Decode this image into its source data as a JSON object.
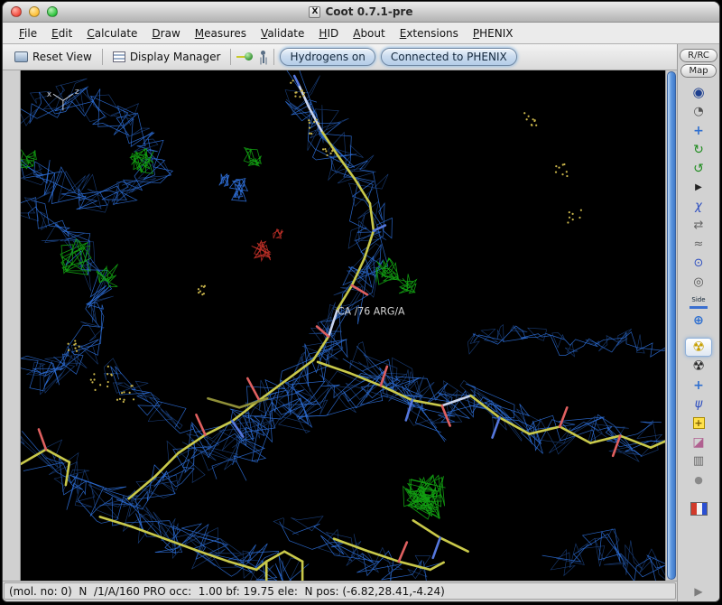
{
  "window": {
    "title": "Coot 0.7.1-pre",
    "icon_glyph": "X"
  },
  "menu": {
    "items": [
      {
        "label": "File"
      },
      {
        "label": "Edit"
      },
      {
        "label": "Calculate"
      },
      {
        "label": "Draw"
      },
      {
        "label": "Measures"
      },
      {
        "label": "Validate"
      },
      {
        "label": "HID"
      },
      {
        "label": "About"
      },
      {
        "label": "Extensions"
      },
      {
        "label": "PHENIX"
      }
    ]
  },
  "toolbar": {
    "reset_view": "Reset View",
    "display_manager": "Display Manager",
    "hydrogens_toggle": "Hydrogens on",
    "phenix_status": "Connected to PHENIX"
  },
  "right_panel": {
    "rrc_button": "R/RC",
    "map_button": "Map",
    "expand_glyph": "▶",
    "icons": [
      {
        "name": "view-sphere",
        "glyph": "◉"
      },
      {
        "name": "clock",
        "glyph": "◔"
      },
      {
        "name": "translate",
        "glyph": "+"
      },
      {
        "name": "rotate-zone",
        "glyph": "↻"
      },
      {
        "name": "torsion",
        "glyph": "↺"
      },
      {
        "name": "play",
        "glyph": "▶"
      },
      {
        "name": "chi-angles",
        "glyph": "χ"
      },
      {
        "name": "flip",
        "glyph": "⇄"
      },
      {
        "name": "backbone",
        "glyph": "≈"
      },
      {
        "name": "sphere-refine",
        "glyph": "⊙"
      },
      {
        "name": "eye",
        "glyph": "◎"
      },
      {
        "name": "side-view",
        "glyph": "Side"
      },
      {
        "name": "pan",
        "glyph": "⊕"
      },
      {
        "name": "real-space-refine",
        "glyph": "☢",
        "selected": true
      },
      {
        "name": "regularize",
        "glyph": "☢"
      },
      {
        "name": "rigid-body",
        "glyph": "+"
      },
      {
        "name": "rotamers",
        "glyph": "ψ"
      },
      {
        "name": "add-residue",
        "glyph": "+"
      },
      {
        "name": "mutate",
        "glyph": "◪"
      },
      {
        "name": "delete",
        "glyph": "▥"
      },
      {
        "name": "sphere",
        "glyph": "●"
      }
    ]
  },
  "canvas": {
    "residue_label": "CA /76 ARG/A",
    "axis_x": "x",
    "axis_z": "z",
    "colors": {
      "density_blue": "#2e6fd8",
      "difference_positive": "#12a012",
      "difference_negative": "#c23028",
      "carbon": "#c9c94a",
      "carbon_dim": "#8f8f38",
      "backbone_light": "#c9d4ee",
      "oxygen": "#e06060",
      "nitrogen": "#5577dd",
      "water_dots": "#c8b44a",
      "label_color": "#d0d0d0"
    }
  },
  "statusbar": {
    "text": "(mol. no: 0)  N  /1/A/160 PRO occ:  1.00 bf: 19.75 ele:  N pos: (-6.82,28.41,-4.24)"
  }
}
